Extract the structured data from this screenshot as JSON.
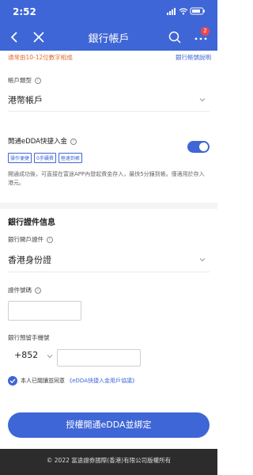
{
  "status": {
    "time": "2:52"
  },
  "nav": {
    "title": "銀行帳戶",
    "badge": "2"
  },
  "hint": {
    "left": "通常由10-12位數字組成",
    "right": "銀行帳號說明"
  },
  "account_type": {
    "label": "帳戶類型",
    "value": "港幣帳戶"
  },
  "edda": {
    "label": "開通eDDA快捷入金",
    "tags": [
      "操作便捷",
      "0手續費",
      "極速到帳"
    ],
    "enabled": true,
    "note": "開通成功後，可直接在富途APP內發起資金存入，最快5分鐘到帳。僅適用於存入港元。"
  },
  "section": {
    "title": "銀行證件信息"
  },
  "id_doc": {
    "label": "銀行開戶證件",
    "value": "香港身份證"
  },
  "id_number": {
    "label": "證件號碼",
    "value": ""
  },
  "phone": {
    "label": "銀行預留手機號",
    "prefix": "+852",
    "value": ""
  },
  "agreement": {
    "text": "本人已閱讀並同意",
    "link": "《eDDA快捷入金用戶協議》",
    "checked": true
  },
  "submit": {
    "label": "授權開通eDDA並綁定"
  },
  "footer": {
    "text": "© 2022 富途證券國際(香港)有限公司版權所有"
  },
  "colors": {
    "primary": "#3f66d6",
    "hint": "#e26b2f",
    "footer_bg": "#2c2c2c"
  },
  "icons": [
    "location-arrow-icon",
    "signal-icon",
    "wifi-icon",
    "battery-icon",
    "back-icon",
    "close-icon",
    "search-icon",
    "more-icon",
    "info-icon",
    "chevron-down-icon",
    "check-icon"
  ]
}
